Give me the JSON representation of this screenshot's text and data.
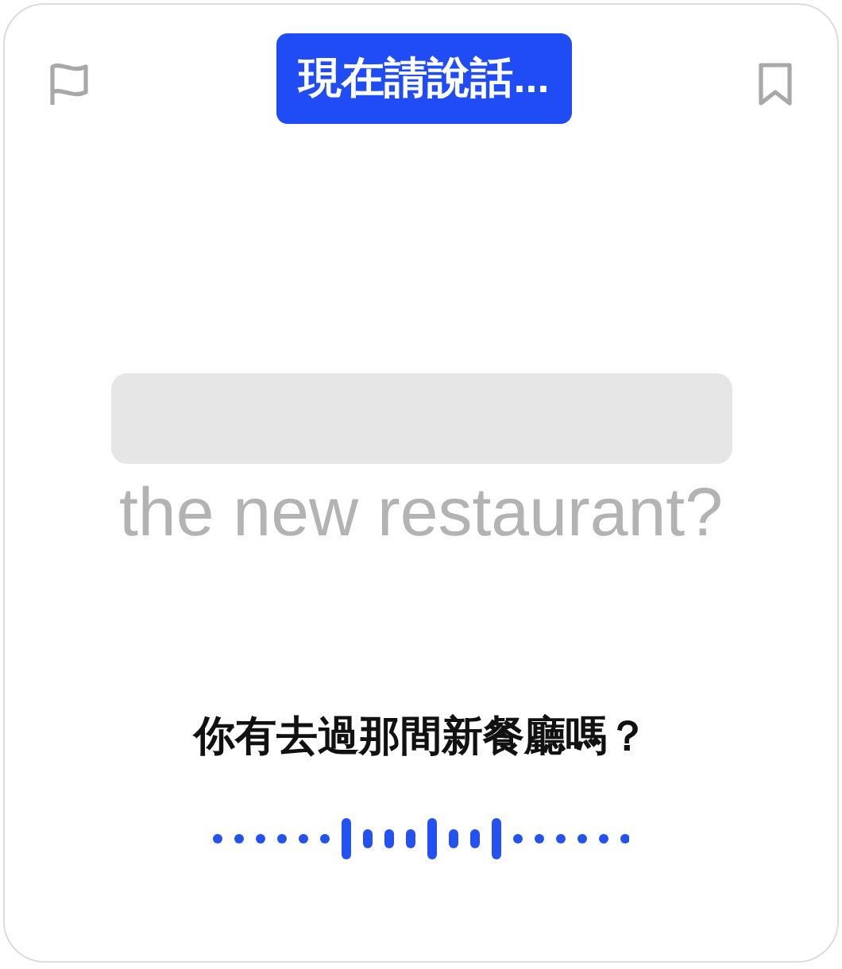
{
  "status_badge": "現在請說話...",
  "english_text": "the new restaurant?",
  "chinese_text": "你有去過那間新餐廳嗎？"
}
